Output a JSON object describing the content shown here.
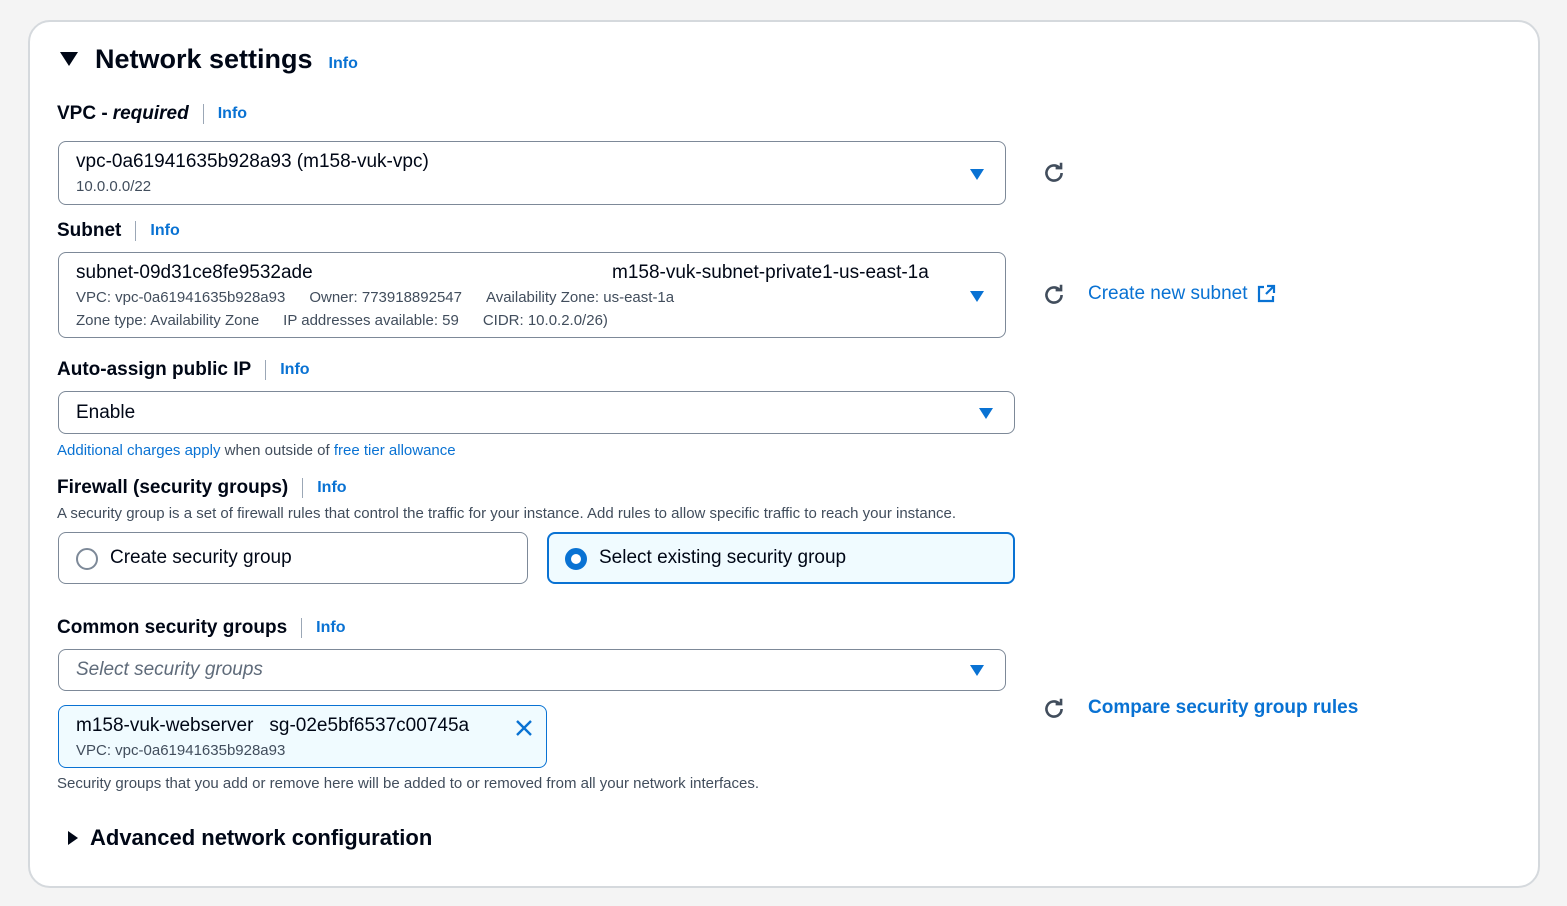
{
  "section": {
    "title": "Network settings",
    "info": "Info"
  },
  "vpc": {
    "label": "VPC - ",
    "label_em": "required",
    "info": "Info",
    "value": "vpc-0a61941635b928a93 (m158-vuk-vpc)",
    "cidr": "10.0.0.0/22"
  },
  "subnet": {
    "label": "Subnet",
    "info": "Info",
    "id": "subnet-09d31ce8fe9532ade",
    "name": "m158-vuk-subnet-private1-us-east-1a",
    "vpc": "VPC: vpc-0a61941635b928a93",
    "owner": "Owner: 773918892547",
    "az": "Availability Zone: us-east-1a",
    "zone_type": "Zone type: Availability Zone",
    "ips": "IP addresses available: 59",
    "cidr": "CIDR: 10.0.2.0/26)",
    "create_link": "Create new subnet"
  },
  "public_ip": {
    "label": "Auto-assign public IP",
    "info": "Info",
    "value": "Enable",
    "hint_link1": "Additional charges apply",
    "hint_mid": " when outside of ",
    "hint_link2": "free tier allowance"
  },
  "firewall": {
    "label": "Firewall (security groups)",
    "info": "Info",
    "description": "A security group is a set of firewall rules that control the traffic for your instance. Add rules to allow specific traffic to reach your instance.",
    "option_create": "Create security group",
    "option_select": "Select existing security group",
    "selected": "select"
  },
  "common_sg": {
    "label": "Common security groups",
    "info": "Info",
    "placeholder": "Select security groups",
    "token_name": "m158-vuk-webserver",
    "token_id": "sg-02e5bf6537c00745a",
    "token_vpc": "VPC: vpc-0a61941635b928a93",
    "compare_link": "Compare security group rules",
    "help": "Security groups that you add or remove here will be added to or removed from all your network interfaces."
  },
  "advanced": {
    "title": "Advanced network configuration"
  },
  "colors": {
    "accent": "#0972d3",
    "text": "#000716"
  }
}
